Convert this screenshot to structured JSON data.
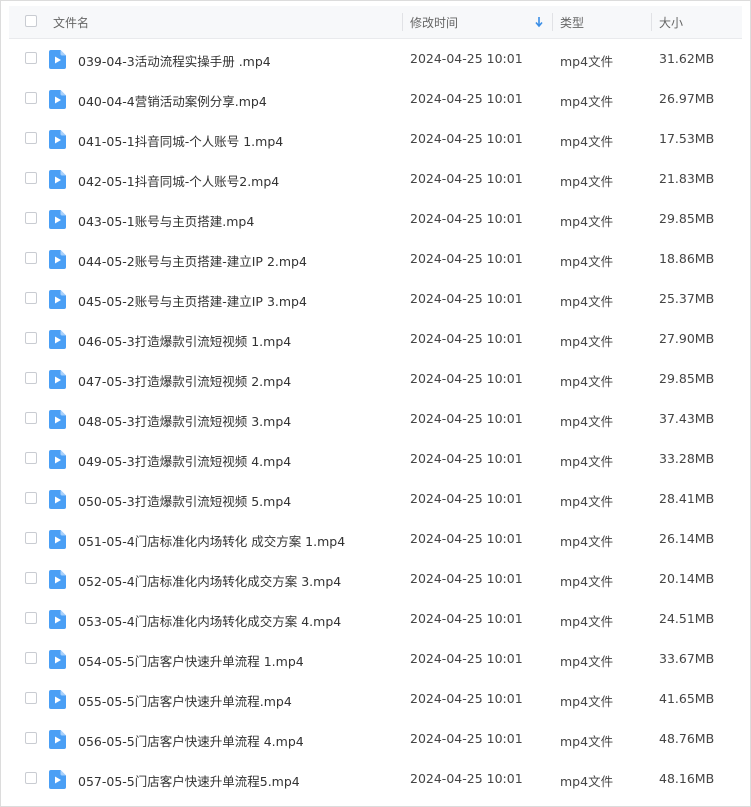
{
  "header": {
    "name_label": "文件名",
    "time_label": "修改时间",
    "type_label": "类型",
    "size_label": "大小"
  },
  "accent": "#3a8ee6",
  "files": [
    {
      "name": "039-04-3活动流程实操手册 .mp4",
      "time": "2024-04-25 10:01",
      "type": "mp4文件",
      "size": "31.62MB"
    },
    {
      "name": "040-04-4营销活动案例分享.mp4",
      "time": "2024-04-25 10:01",
      "type": "mp4文件",
      "size": "26.97MB"
    },
    {
      "name": "041-05-1抖音同城-个人账号 1.mp4",
      "time": "2024-04-25 10:01",
      "type": "mp4文件",
      "size": "17.53MB"
    },
    {
      "name": "042-05-1抖音同城-个人账号2.mp4",
      "time": "2024-04-25 10:01",
      "type": "mp4文件",
      "size": "21.83MB"
    },
    {
      "name": "043-05-1账号与主页搭建.mp4",
      "time": "2024-04-25 10:01",
      "type": "mp4文件",
      "size": "29.85MB"
    },
    {
      "name": "044-05-2账号与主页搭建-建立IP 2.mp4",
      "time": "2024-04-25 10:01",
      "type": "mp4文件",
      "size": "18.86MB"
    },
    {
      "name": "045-05-2账号与主页搭建-建立IP 3.mp4",
      "time": "2024-04-25 10:01",
      "type": "mp4文件",
      "size": "25.37MB"
    },
    {
      "name": "046-05-3打造爆款引流短视频 1.mp4",
      "time": "2024-04-25 10:01",
      "type": "mp4文件",
      "size": "27.90MB"
    },
    {
      "name": "047-05-3打造爆款引流短视频 2.mp4",
      "time": "2024-04-25 10:01",
      "type": "mp4文件",
      "size": "29.85MB"
    },
    {
      "name": "048-05-3打造爆款引流短视频 3.mp4",
      "time": "2024-04-25 10:01",
      "type": "mp4文件",
      "size": "37.43MB"
    },
    {
      "name": "049-05-3打造爆款引流短视频 4.mp4",
      "time": "2024-04-25 10:01",
      "type": "mp4文件",
      "size": "33.28MB"
    },
    {
      "name": "050-05-3打造爆款引流短视频 5.mp4",
      "time": "2024-04-25 10:01",
      "type": "mp4文件",
      "size": "28.41MB"
    },
    {
      "name": "051-05-4门店标准化内场转化 成交方案 1.mp4",
      "time": "2024-04-25 10:01",
      "type": "mp4文件",
      "size": "26.14MB"
    },
    {
      "name": "052-05-4门店标准化内场转化成交方案 3.mp4",
      "time": "2024-04-25 10:01",
      "type": "mp4文件",
      "size": "20.14MB"
    },
    {
      "name": "053-05-4门店标准化内场转化成交方案 4.mp4",
      "time": "2024-04-25 10:01",
      "type": "mp4文件",
      "size": "24.51MB"
    },
    {
      "name": "054-05-5门店客户快速升单流程 1.mp4",
      "time": "2024-04-25 10:01",
      "type": "mp4文件",
      "size": "33.67MB"
    },
    {
      "name": "055-05-5门店客户快速升单流程.mp4",
      "time": "2024-04-25 10:01",
      "type": "mp4文件",
      "size": "41.65MB"
    },
    {
      "name": "056-05-5门店客户快速升单流程 4.mp4",
      "time": "2024-04-25 10:01",
      "type": "mp4文件",
      "size": "48.76MB"
    },
    {
      "name": "057-05-5门店客户快速升单流程5.mp4",
      "time": "2024-04-25 10:01",
      "type": "mp4文件",
      "size": "48.16MB"
    }
  ]
}
